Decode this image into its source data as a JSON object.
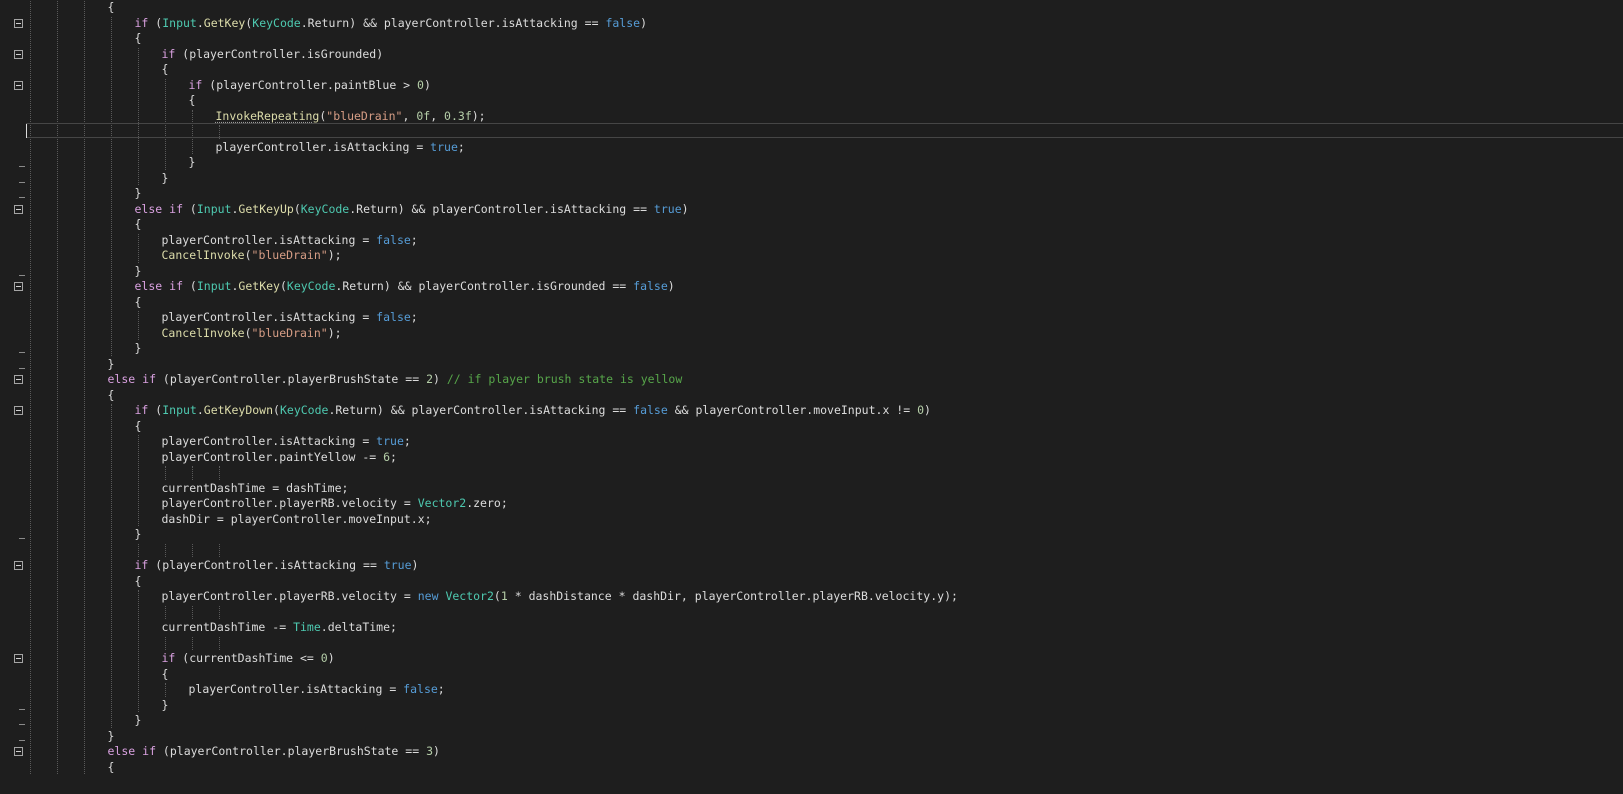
{
  "editor": {
    "language": "C#",
    "theme_colors": {
      "background": "#1e1e1e",
      "plain": "#dcdcdc",
      "keyword": "#569cd6",
      "control": "#d8a0df",
      "type": "#4ec9b0",
      "method": "#dcdcaa",
      "string": "#d69d85",
      "number": "#b5cea8",
      "comment": "#57a64a"
    },
    "lines": [
      {
        "indent": 3,
        "text": "{"
      },
      {
        "indent": 4,
        "fold": true,
        "text": "if (Input.GetKey(KeyCode.Return) && playerController.isAttacking == false)"
      },
      {
        "indent": 4,
        "text": "{"
      },
      {
        "indent": 5,
        "fold": true,
        "text": "if (playerController.isGrounded)"
      },
      {
        "indent": 5,
        "text": "{"
      },
      {
        "indent": 6,
        "fold": true,
        "text": "if (playerController.paintBlue > 0)"
      },
      {
        "indent": 6,
        "text": "{"
      },
      {
        "indent": 7,
        "text": "InvokeRepeating(\"blueDrain\", 0f, 0.3f);"
      },
      {
        "indent": 7,
        "text": "",
        "current": true
      },
      {
        "indent": 7,
        "text": "playerController.isAttacking = true;"
      },
      {
        "indent": 6,
        "text": "}"
      },
      {
        "indent": 5,
        "text": "}"
      },
      {
        "indent": 4,
        "text": "}"
      },
      {
        "indent": 4,
        "fold": true,
        "text": "else if (Input.GetKeyUp(KeyCode.Return) && playerController.isAttacking == true)"
      },
      {
        "indent": 4,
        "text": "{"
      },
      {
        "indent": 5,
        "text": "playerController.isAttacking = false;"
      },
      {
        "indent": 5,
        "text": "CancelInvoke(\"blueDrain\");"
      },
      {
        "indent": 4,
        "text": "}"
      },
      {
        "indent": 4,
        "fold": true,
        "text": "else if (Input.GetKey(KeyCode.Return) && playerController.isGrounded == false)"
      },
      {
        "indent": 4,
        "text": "{"
      },
      {
        "indent": 5,
        "text": "playerController.isAttacking = false;"
      },
      {
        "indent": 5,
        "text": "CancelInvoke(\"blueDrain\");"
      },
      {
        "indent": 4,
        "text": "}"
      },
      {
        "indent": 3,
        "text": "}"
      },
      {
        "indent": 3,
        "fold": true,
        "text": "else if (playerController.playerBrushState == 2) // if player brush state is yellow"
      },
      {
        "indent": 3,
        "text": "{"
      },
      {
        "indent": 4,
        "fold": true,
        "text": "if (Input.GetKeyDown(KeyCode.Return) && playerController.isAttacking == false && playerController.moveInput.x != 0)"
      },
      {
        "indent": 4,
        "text": "{"
      },
      {
        "indent": 5,
        "text": "playerController.isAttacking = true;"
      },
      {
        "indent": 5,
        "text": "playerController.paintYellow -= 6;"
      },
      {
        "indent": 5,
        "text": ""
      },
      {
        "indent": 5,
        "text": "currentDashTime = dashTime;"
      },
      {
        "indent": 5,
        "text": "playerController.playerRB.velocity = Vector2.zero;"
      },
      {
        "indent": 5,
        "text": "dashDir = playerController.moveInput.x;"
      },
      {
        "indent": 4,
        "text": "}"
      },
      {
        "indent": 4,
        "text": ""
      },
      {
        "indent": 4,
        "fold": true,
        "text": "if (playerController.isAttacking == true)"
      },
      {
        "indent": 4,
        "text": "{"
      },
      {
        "indent": 5,
        "text": "playerController.playerRB.velocity = new Vector2(1 * dashDistance * dashDir, playerController.playerRB.velocity.y);"
      },
      {
        "indent": 5,
        "text": ""
      },
      {
        "indent": 5,
        "text": "currentDashTime -= Time.deltaTime;"
      },
      {
        "indent": 5,
        "text": ""
      },
      {
        "indent": 5,
        "fold": true,
        "text": "if (currentDashTime <= 0)"
      },
      {
        "indent": 5,
        "text": "{"
      },
      {
        "indent": 6,
        "text": "playerController.isAttacking = false;"
      },
      {
        "indent": 5,
        "text": "}"
      },
      {
        "indent": 4,
        "text": "}"
      },
      {
        "indent": 3,
        "text": "}"
      },
      {
        "indent": 3,
        "fold": true,
        "text": "else if (playerController.playerBrushState == 3)"
      },
      {
        "indent": 3,
        "text": "{"
      }
    ]
  }
}
